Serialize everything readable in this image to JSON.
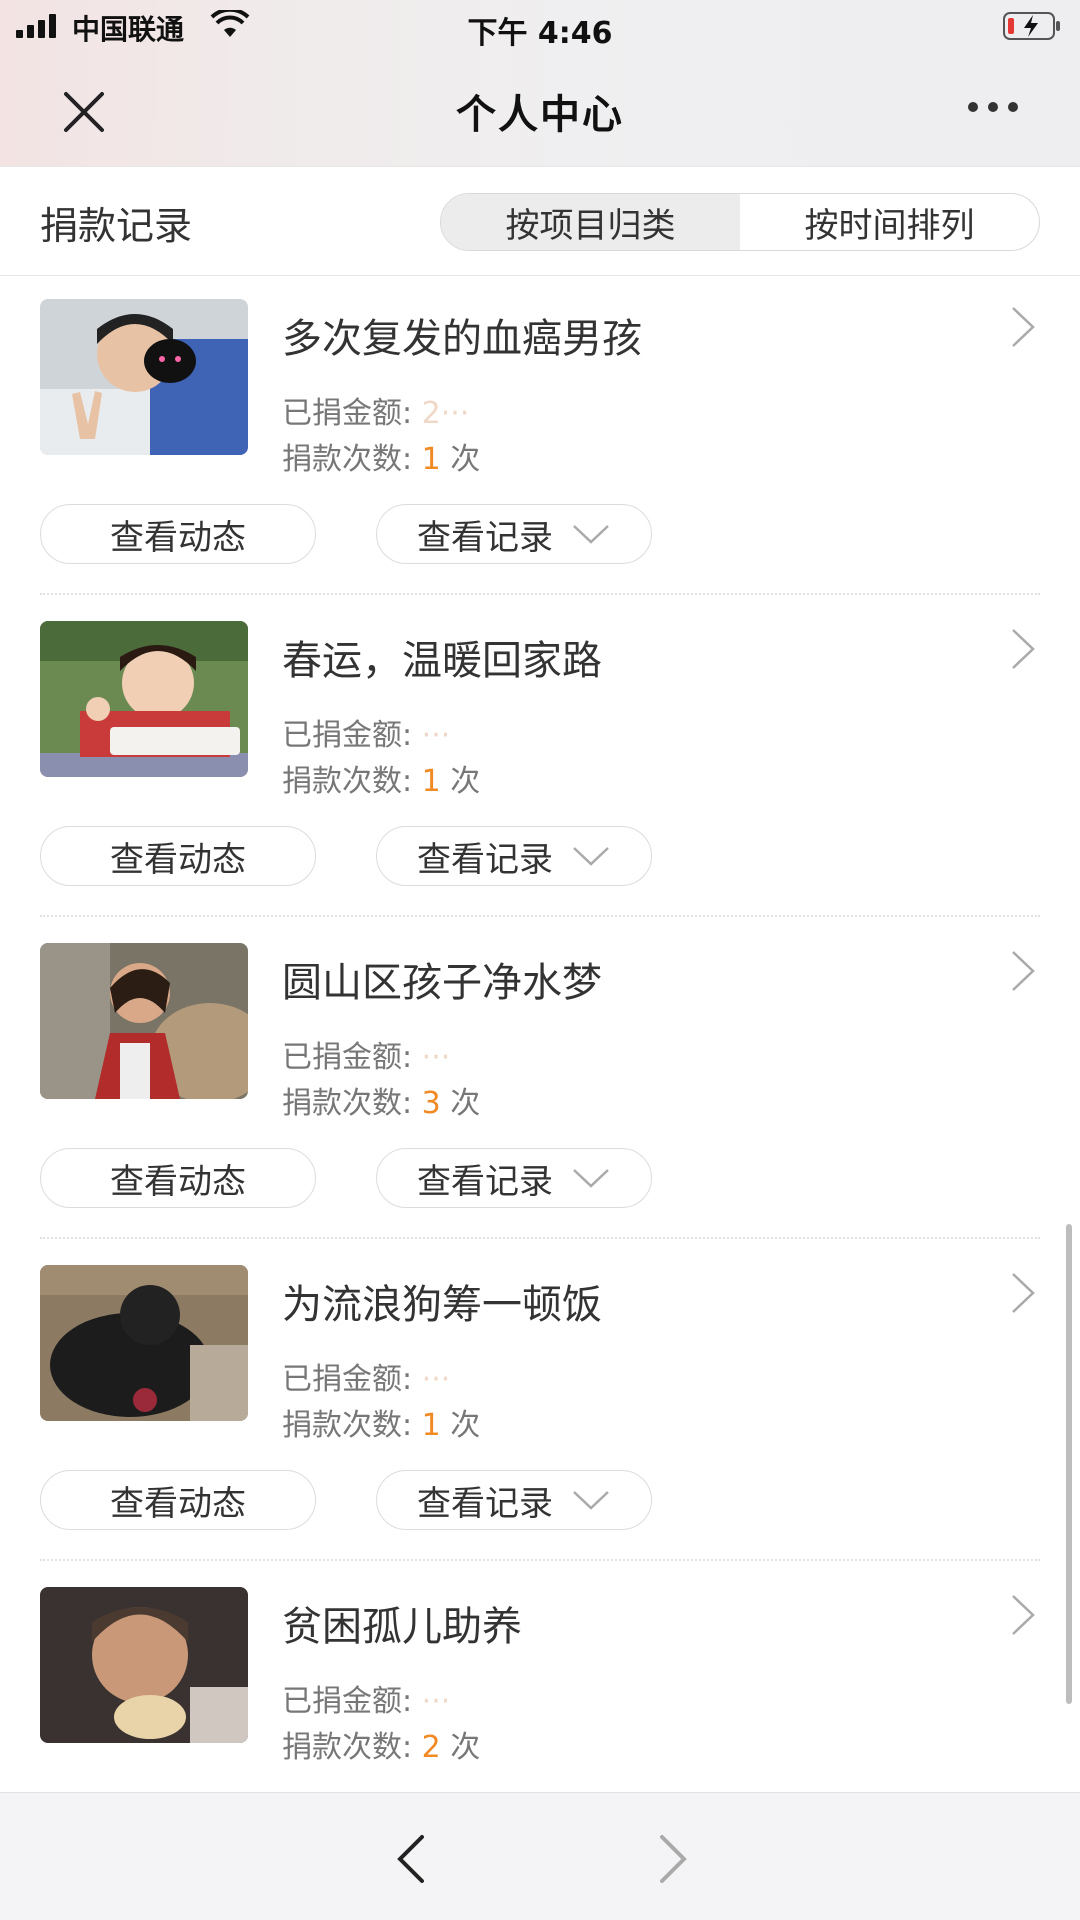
{
  "status": {
    "carrier": "中国联通",
    "time": "下午 4:46"
  },
  "nav": {
    "title": "个人中心",
    "close_icon": "close-icon",
    "more_icon": "more-icon"
  },
  "subheader": {
    "title": "捐款记录",
    "segments": [
      {
        "label": "按项目归类",
        "active": true
      },
      {
        "label": "按时间排列",
        "active": false
      }
    ]
  },
  "labels": {
    "amount_prefix": "已捐金额:",
    "count_prefix": "捐款次数:",
    "count_suffix": "次",
    "view_news": "查看动态",
    "view_records": "查看记录"
  },
  "items": [
    {
      "title": "多次复发的血癌男孩",
      "count": "1",
      "thumb": "child-hospital-photo"
    },
    {
      "title": "春运，温暖回家路",
      "count": "1",
      "thumb": "child-eating-photo"
    },
    {
      "title": "圆山区孩子净水梦",
      "count": "3",
      "thumb": "child-water-photo"
    },
    {
      "title": "为流浪狗筹一顿饭",
      "count": "1",
      "thumb": "stray-dog-photo"
    },
    {
      "title": "贫困孤儿助养",
      "count": "2",
      "thumb": "orphan-child-photo"
    }
  ],
  "colors": {
    "accent_orange": "#f08a24",
    "text_main": "#333333",
    "text_sub": "#777777"
  }
}
